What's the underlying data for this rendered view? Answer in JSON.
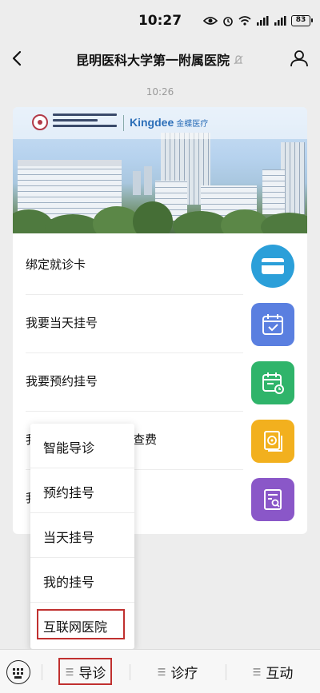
{
  "status_bar": {
    "time": "10:27",
    "battery": "83"
  },
  "nav": {
    "title": "昆明医科大学第一附属医院"
  },
  "chat": {
    "timestamp": "10:26"
  },
  "banner": {
    "partner": "Kingdee",
    "partner_suffix": "金蝶医疗"
  },
  "menu": [
    {
      "label": "绑定就诊卡",
      "icon": "card-icon",
      "color": "#2b9fd9"
    },
    {
      "label": "我要当天挂号",
      "icon": "calendar-check-icon",
      "color": "#5a7fe0"
    },
    {
      "label": "我要预约挂号",
      "icon": "calendar-clock-icon",
      "color": "#2fb46a"
    },
    {
      "label": "查费",
      "icon": "money-icon",
      "color": "#f2b01e"
    },
    {
      "label": "",
      "icon": "report-icon",
      "color": "#8a57c8"
    }
  ],
  "row4_prefix": "我",
  "row5_prefix": "我",
  "popup": {
    "items": [
      "智能导诊",
      "预约挂号",
      "当天挂号",
      "我的挂号",
      "互联网医院"
    ]
  },
  "bottom_bar": {
    "items": [
      "导诊",
      "诊疗",
      "互动"
    ]
  },
  "colors": {
    "highlight": "#c0302f",
    "background": "#ededed"
  }
}
